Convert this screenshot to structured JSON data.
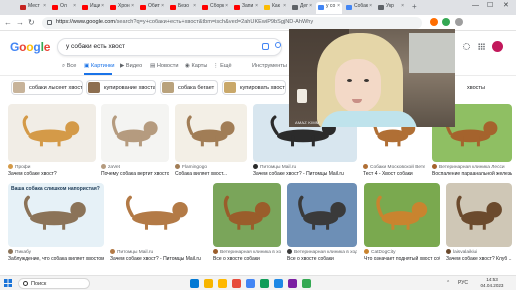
{
  "browser": {
    "tabs": [
      {
        "label": "Мест",
        "color": "#c5221f"
      },
      {
        "label": "Ол",
        "color": "#ff0000"
      },
      {
        "label": "Ищи",
        "color": "#ff0000"
      },
      {
        "label": "Хрон",
        "color": "#ff0000"
      },
      {
        "label": "Обит",
        "color": "#ff0000"
      },
      {
        "label": "Безо",
        "color": "#ff0000"
      },
      {
        "label": "Сборк",
        "color": "#ff0000"
      },
      {
        "label": "Запи",
        "color": "#ff0000"
      },
      {
        "label": "Как",
        "color": "#fbbc04"
      },
      {
        "label": "Деп",
        "color": "#5f6368"
      },
      {
        "label": "у со",
        "color": "#4285f4"
      },
      {
        "label": "Собак",
        "color": "#4285f4"
      },
      {
        "label": "Укр",
        "color": "#5f6368"
      }
    ],
    "new_tab": "+",
    "window_controls": {
      "minimize": "—",
      "maximize": "☐",
      "close": "✕"
    },
    "url_domain": "https://www.google.com",
    "url_path": "/search?q=у+собаки+есть+хвост&tbm=isch&ved=2ahUKEwiP9bSgjND-AhWhy"
  },
  "google": {
    "logo": [
      "G",
      "o",
      "o",
      "g",
      "l",
      "e"
    ],
    "query": "у собаки есть хвост",
    "clear": "✕",
    "tabs": [
      "Все",
      "Картинки",
      "Видео",
      "Новости",
      "Карты",
      "Ещё"
    ],
    "tools": "Инструменты",
    "right_chip_text": "хвосты"
  },
  "chips": [
    {
      "label": "собаки лысеет хвост",
      "color": "#c7b39a"
    },
    {
      "label": "купирование хвоста",
      "color": "#8d6e4f"
    },
    {
      "label": "собака бегает",
      "color": "#b9a27c"
    },
    {
      "label": "купировать хвост",
      "color": "#c9a86a"
    }
  ],
  "results_row1": [
    {
      "source": "Профи",
      "caption": "Зачем собаке хвост?",
      "color": "#f1ede6",
      "accent": "#d49a48"
    },
    {
      "source": "zaVet",
      "caption": "Почему собака вертит хвостом...",
      "color": "#f4f4f2",
      "accent": "#b59b7f"
    },
    {
      "source": "Flamingogo",
      "caption": "Собака виляет хвост...",
      "color": "#f3efe6",
      "accent": "#a17d56"
    },
    {
      "source": "Питомцы Mail.ru",
      "caption": "Зачем собаке хвост? - Питомцы Mail.ru",
      "color": "#d8e6ef",
      "accent": "#2b2b2b"
    },
    {
      "source": "Собаки Московской Ветел...",
      "caption": "Тест 4 - Хвост собаки",
      "color": "#ffffff",
      "accent": "#b06f35"
    },
    {
      "source": "Ветеринарная клиника Лесси",
      "caption": "Воспаление параанальной железы ...",
      "color": "#8fbf63",
      "accent": "#a5632d"
    }
  ],
  "results_row2": [
    {
      "source": "Пикабу",
      "caption": "Заблуждение, что собака виляет хвостом от ...",
      "color": "#e6f1f7",
      "accent": "#8b7358",
      "title": "Ваша собака слишком напористая?"
    },
    {
      "source": "Питомцы Mail.ru",
      "caption": "Зачем собаке хвост? - Питомцы Mail.ru",
      "color": "#ffffff",
      "accent": "#b37a46"
    },
    {
      "source": "Ветеринарная клиника в ходах...",
      "caption": "Все о хвосте собаки",
      "color": "#7aa55a",
      "accent": "#9a5d2b"
    },
    {
      "source": "Ветеринарная клиника в ходах...",
      "caption": "Все о хвосте собаки",
      "color": "#6d8fb6",
      "accent": "#3a3a3a"
    },
    {
      "source": "CatDogCity",
      "caption": "Что означает поднятый хвост собаки?",
      "color": "#7aa94f",
      "accent": "#c9842f"
    },
    {
      "source": "laisvalaikiui",
      "caption": "Зачем собаке хвост? Клуб ...",
      "color": "#cfc7b6",
      "accent": "#6b4a2d"
    }
  ],
  "camera": {
    "label": "AMAZ KIMM"
  },
  "taskbar": {
    "search_label": "Поиск",
    "lang": "РУС",
    "time": "14:53",
    "date": "04.04.2023",
    "icons": [
      "#0078d4",
      "#f7b500",
      "#ffb900",
      "#e74c3c",
      "#4285f4",
      "#0f9d58",
      "#1e88e5",
      "#7b1fa2",
      "#34a853"
    ]
  }
}
